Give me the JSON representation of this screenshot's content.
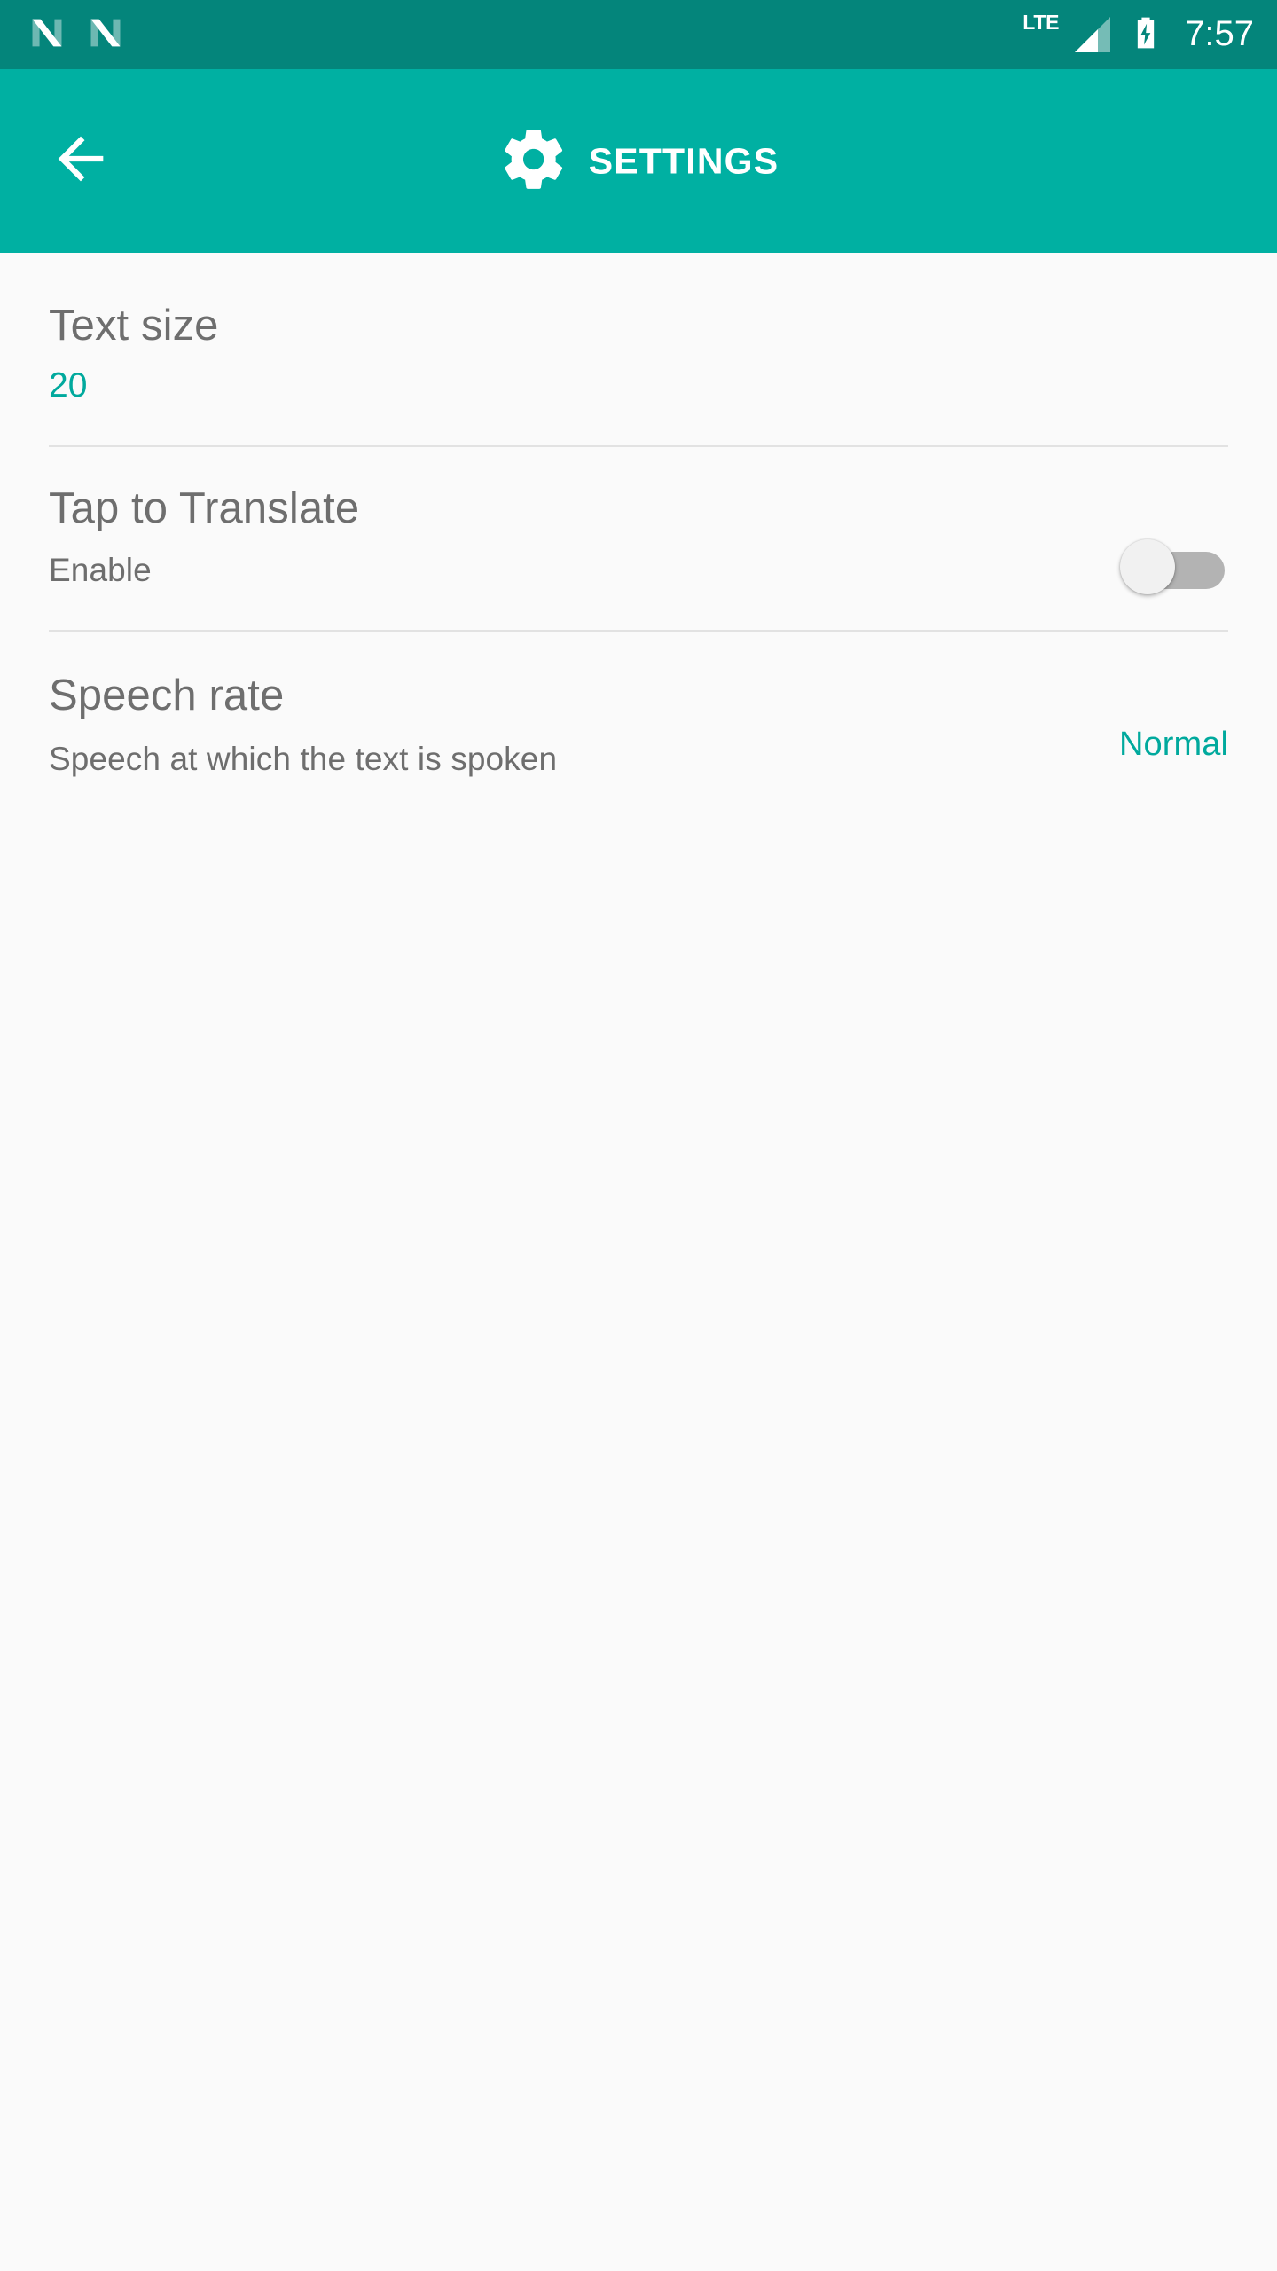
{
  "theme": {
    "status_bar_color": "#04857b",
    "app_bar_color": "#00b0a2",
    "background_color": "#fafafa",
    "accent_color": "#00a99d",
    "primary_text_color": "#6e6e6e",
    "divider_color": "#e2e2e2"
  },
  "status_bar": {
    "notification_icons": [
      {
        "name": "android-n-logo-icon"
      },
      {
        "name": "android-n-logo-icon"
      }
    ],
    "network_label": "LTE",
    "signal_icon": "signal-bars-icon",
    "battery_icon": "battery-charging-icon",
    "clock": "7:57"
  },
  "app_bar": {
    "back_icon": "arrow-back-icon",
    "gear_icon": "settings-gear-icon",
    "title": "SETTINGS"
  },
  "settings": {
    "rows": [
      {
        "id": "text-size",
        "title": "Text size",
        "value": "20",
        "value_style": "accent"
      },
      {
        "id": "tap-to-translate",
        "title": "Tap to Translate",
        "subtitle": "Enable",
        "control": "switch",
        "switch_state": "off"
      },
      {
        "id": "speech-rate",
        "title": "Speech rate",
        "subtitle": "Speech at which the text is spoken",
        "value": "Normal",
        "value_style": "accent"
      }
    ]
  }
}
